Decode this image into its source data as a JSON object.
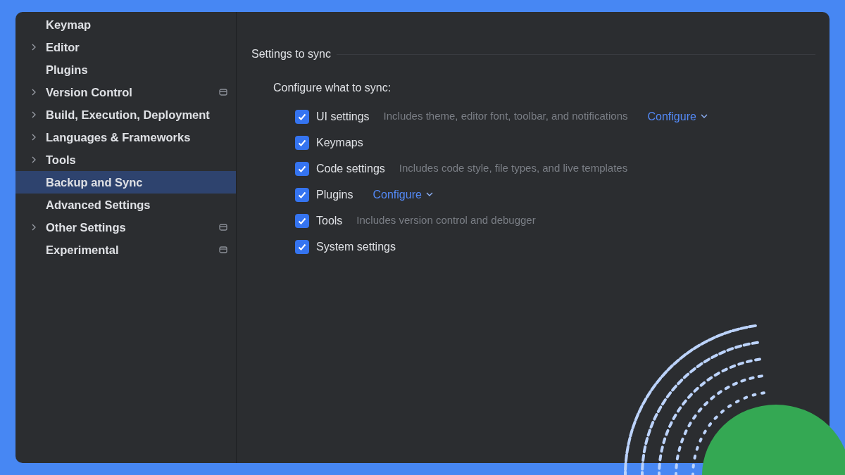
{
  "sidebar": {
    "items": [
      {
        "label": "Keymap",
        "expandable": false,
        "badge": false,
        "selected": false
      },
      {
        "label": "Editor",
        "expandable": true,
        "badge": false,
        "selected": false
      },
      {
        "label": "Plugins",
        "expandable": false,
        "badge": false,
        "selected": false
      },
      {
        "label": "Version Control",
        "expandable": true,
        "badge": true,
        "selected": false
      },
      {
        "label": "Build, Execution, Deployment",
        "expandable": true,
        "badge": false,
        "selected": false
      },
      {
        "label": "Languages & Frameworks",
        "expandable": true,
        "badge": false,
        "selected": false
      },
      {
        "label": "Tools",
        "expandable": true,
        "badge": false,
        "selected": false
      },
      {
        "label": "Backup and Sync",
        "expandable": false,
        "badge": false,
        "selected": true
      },
      {
        "label": "Advanced Settings",
        "expandable": false,
        "badge": false,
        "selected": false
      },
      {
        "label": "Other Settings",
        "expandable": true,
        "badge": true,
        "selected": false
      },
      {
        "label": "Experimental",
        "expandable": false,
        "badge": true,
        "selected": false
      }
    ]
  },
  "section": {
    "title": "Settings to sync",
    "subtitle": "Configure what to sync:",
    "options": [
      {
        "label": "UI settings",
        "checked": true,
        "description": "Includes theme, editor font, toolbar, and notifications",
        "link": "Configure"
      },
      {
        "label": "Keymaps",
        "checked": true
      },
      {
        "label": "Code settings",
        "checked": true,
        "description": "Includes code style, file types, and live templates"
      },
      {
        "label": "Plugins",
        "checked": true,
        "link": "Configure"
      },
      {
        "label": "Tools",
        "checked": true,
        "description": "Includes version control and debugger"
      },
      {
        "label": "System settings",
        "checked": true
      }
    ]
  }
}
